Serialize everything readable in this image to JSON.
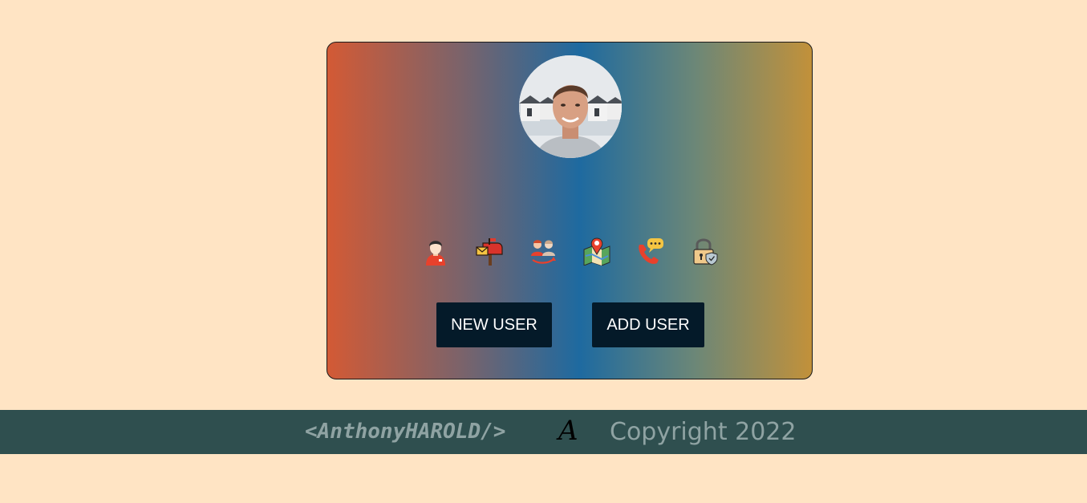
{
  "card": {
    "avatar_alt": "user avatar",
    "icons": [
      {
        "name": "user-icon"
      },
      {
        "name": "mailbox-icon"
      },
      {
        "name": "users-icon"
      },
      {
        "name": "map-icon"
      },
      {
        "name": "phone-chat-icon"
      },
      {
        "name": "lock-icon"
      }
    ],
    "buttons": {
      "new_user": "NEW USER",
      "add_user": "ADD USER"
    },
    "colors": {
      "gradient_left": "#d35a35",
      "gradient_mid": "#1e6aa0",
      "gradient_right": "#c2913a",
      "button_bg": "#041a29"
    }
  },
  "footer": {
    "brand": "<AnthonyHAROLD/>",
    "logo": "A",
    "copyright": "Copyright 2022"
  },
  "page": {
    "background": "#ffe4c4",
    "footer_bg": "#2f4f4f"
  }
}
